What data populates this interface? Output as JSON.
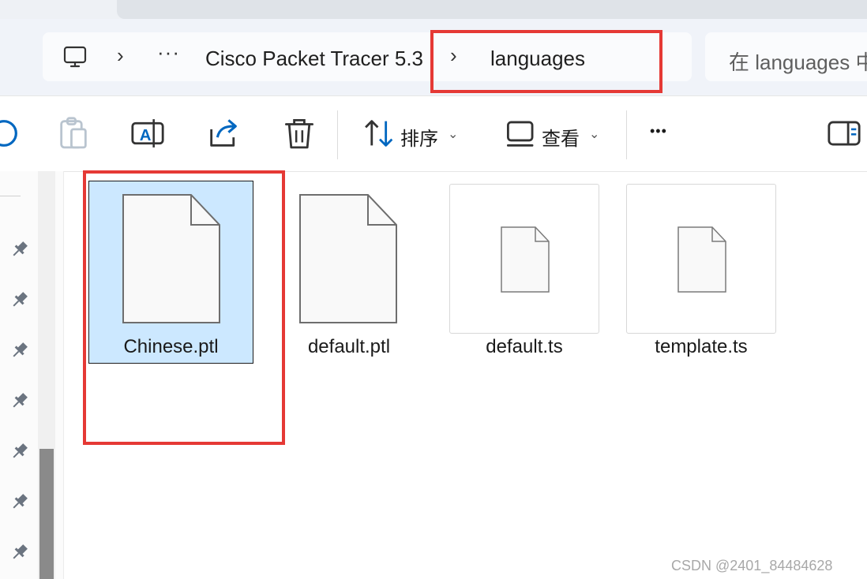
{
  "breadcrumb": {
    "overflow": "···",
    "segments": [
      "Cisco Packet Tracer 5.3",
      "languages"
    ]
  },
  "search": {
    "placeholder": "在 languages 中"
  },
  "left_glyph": "”",
  "toolbar": {
    "sort_label": "排序",
    "view_label": "查看",
    "more": "•••"
  },
  "files": [
    {
      "name": "Chinese.ptl",
      "selected": true
    },
    {
      "name": "default.ptl",
      "selected": false
    },
    {
      "name": "default.ts",
      "selected": false
    },
    {
      "name": "template.ts",
      "selected": false
    }
  ],
  "watermark": "CSDN @2401_84484628",
  "colors": {
    "highlight": "#e53935",
    "selection": "#cce8ff",
    "accent": "#0067c0"
  }
}
